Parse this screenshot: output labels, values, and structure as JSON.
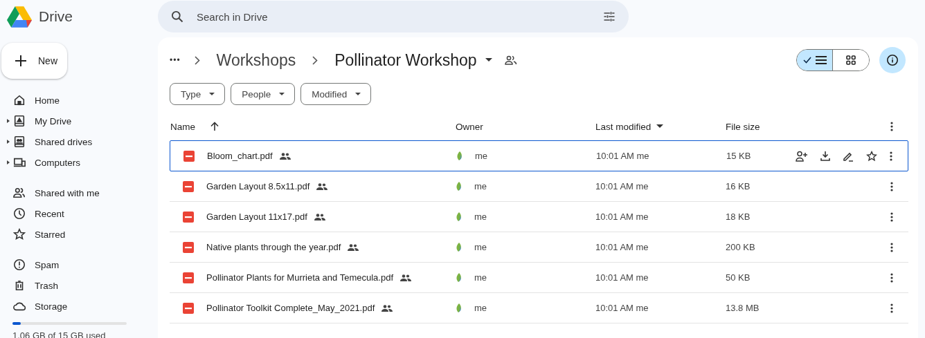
{
  "app": {
    "name": "Drive"
  },
  "search": {
    "placeholder": "Search in Drive"
  },
  "new_button": {
    "label": "New"
  },
  "sidebar": {
    "groups": [
      [
        {
          "label": "Home",
          "kind": "home",
          "expandable": false
        },
        {
          "label": "My Drive",
          "kind": "mydrive",
          "expandable": true
        },
        {
          "label": "Shared drives",
          "kind": "shareddrives",
          "expandable": true
        },
        {
          "label": "Computers",
          "kind": "computers",
          "expandable": true
        }
      ],
      [
        {
          "label": "Shared with me",
          "kind": "people",
          "expandable": false
        },
        {
          "label": "Recent",
          "kind": "clock",
          "expandable": false
        },
        {
          "label": "Starred",
          "kind": "star",
          "expandable": false
        }
      ],
      [
        {
          "label": "Spam",
          "kind": "spam",
          "expandable": false
        },
        {
          "label": "Trash",
          "kind": "trash",
          "expandable": false
        },
        {
          "label": "Storage",
          "kind": "cloud",
          "expandable": false
        }
      ]
    ],
    "storage": {
      "level": 0.07,
      "text": "1.06 GB of 15 GB used"
    }
  },
  "breadcrumb": {
    "more": "•••",
    "items": [
      "Workshops",
      "Pollinator Workshop"
    ],
    "shared": true
  },
  "view_toggle": [
    {
      "kind": "list",
      "selected": true
    },
    {
      "kind": "grid",
      "selected": false
    }
  ],
  "details_button": {
    "on": true
  },
  "filters": [
    "Type",
    "People",
    "Modified"
  ],
  "table": {
    "columns": [
      "Name",
      "Owner",
      "Last modified",
      "File size"
    ],
    "rows": [
      {
        "name": "Bloom_chart.pdf",
        "shared": true,
        "owner": "me",
        "modified": "10:01 AM me",
        "size": "15 KB",
        "selected": true
      },
      {
        "name": "Garden Layout 8.5x11.pdf",
        "shared": true,
        "owner": "me",
        "modified": "10:01 AM me",
        "size": "16 KB",
        "selected": false
      },
      {
        "name": "Garden Layout 11x17.pdf",
        "shared": true,
        "owner": "me",
        "modified": "10:01 AM me",
        "size": "18 KB",
        "selected": false
      },
      {
        "name": "Native plants through the year.pdf",
        "shared": true,
        "owner": "me",
        "modified": "10:01 AM me",
        "size": "200 KB",
        "selected": false
      },
      {
        "name": "Pollinator Plants for Murrieta and Temecula.pdf",
        "shared": true,
        "owner": "me",
        "modified": "10:01 AM me",
        "size": "50 KB",
        "selected": false
      },
      {
        "name": "Pollinator Toolkit Complete_May_2021.pdf",
        "shared": true,
        "owner": "me",
        "modified": "10:01 AM me",
        "size": "13.8 MB",
        "selected": false
      }
    ]
  }
}
